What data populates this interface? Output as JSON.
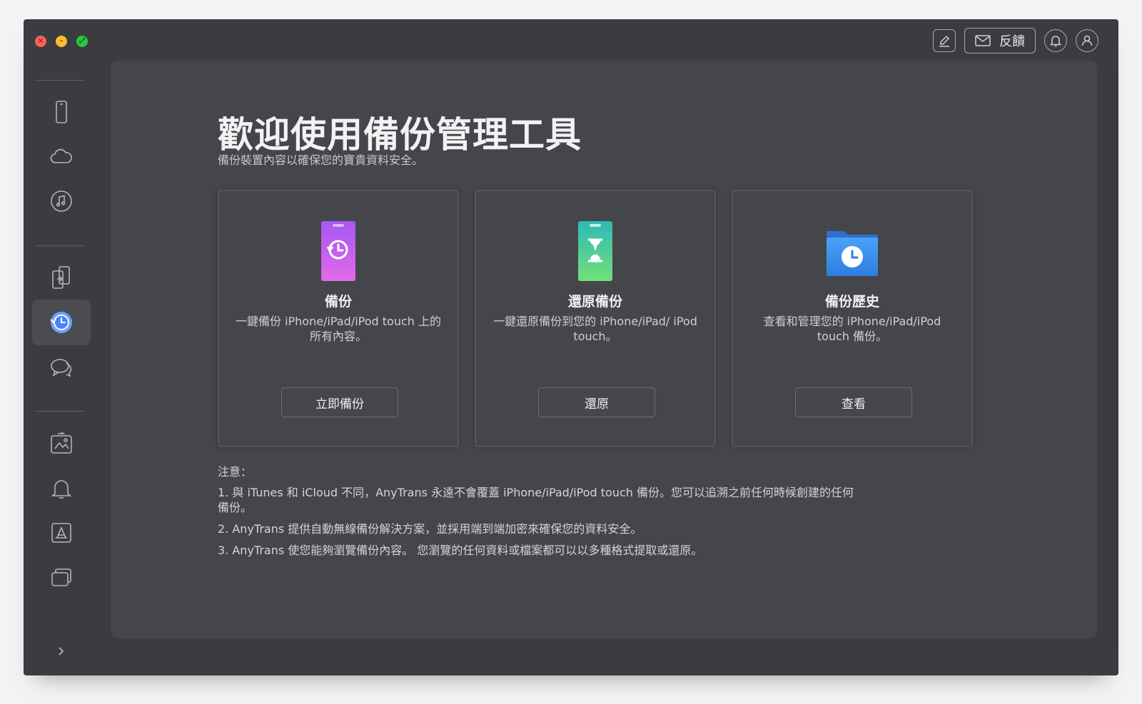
{
  "window": {
    "traffic_lights": [
      "close",
      "minimize",
      "zoom"
    ]
  },
  "toolbar": {
    "edit_icon": "edit-note-icon",
    "feedback_label": "反饋",
    "feedback_icon": "mail-icon",
    "bell_icon": "bell-icon",
    "account_icon": "user-icon"
  },
  "sidebar": {
    "items": [
      {
        "icon": "phone-icon",
        "active": false
      },
      {
        "icon": "cloud-icon",
        "active": false
      },
      {
        "icon": "music-icon",
        "active": false
      },
      {
        "icon": "phone-transfer-icon",
        "active": false
      },
      {
        "icon": "backup-clock-icon",
        "active": true
      },
      {
        "icon": "chat-bubbles-icon",
        "active": false
      },
      {
        "icon": "photo-sync-icon",
        "active": false
      },
      {
        "icon": "ringtone-bell-icon",
        "active": false
      },
      {
        "icon": "app-store-icon",
        "active": false
      },
      {
        "icon": "screens-icon",
        "active": false
      }
    ],
    "expand_icon": "chevron-right-icon"
  },
  "main": {
    "title": "歡迎使用備份管理工具",
    "subtitle": "備份裝置內容以確保您的寶貴資料安全。",
    "cards": [
      {
        "title": "備份",
        "description": "一鍵備份 iPhone/iPad/iPod touch 上的所有內容。",
        "button": "立即備份",
        "icon": "phone-backup-icon",
        "color": "#c259f0"
      },
      {
        "title": "還原備份",
        "description": "一鍵還原備份到您的 iPhone/iPad/ iPod touch。",
        "button": "還原",
        "icon": "phone-hourglass-icon",
        "color": "#3fd0a4"
      },
      {
        "title": "備份歷史",
        "description": "查看和管理您的 iPhone/iPad/iPod touch 備份。",
        "button": "查看",
        "icon": "folder-clock-icon",
        "color": "#3a8fe8"
      }
    ],
    "notes": {
      "heading": "注意：",
      "items": [
        "1. 與 iTunes 和 iCloud 不同，AnyTrans 永遠不會覆蓋 iPhone/iPad/iPod touch 備份。您可以追溯之前任何時候創建的任何備份。",
        "2. AnyTrans 提供自動無線備份解決方案，並採用端到端加密來確保您的資料安全。",
        "3. AnyTrans 使您能夠瀏覽備份內容。 您瀏覽的任何資料或檔案都可以以多種格式提取或還原。"
      ]
    }
  }
}
